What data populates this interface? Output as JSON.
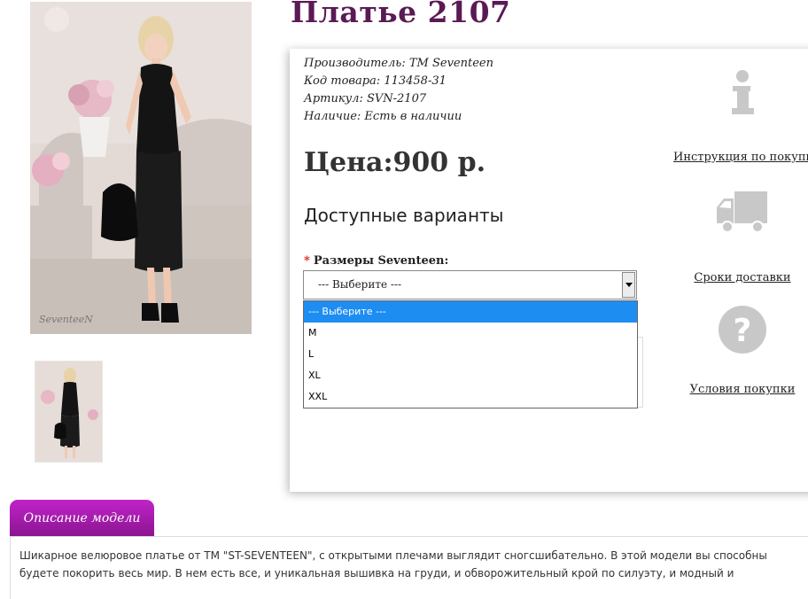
{
  "product": {
    "title": "Платье 2107",
    "meta": [
      {
        "label": "Производитель:",
        "value": "TM Seventeen"
      },
      {
        "label": "Код товара:",
        "value": "113458-31"
      },
      {
        "label": "Артикул:",
        "value": "SVN-2107"
      },
      {
        "label": "Наличие:",
        "value": "Есть в наличии"
      }
    ],
    "price": "Цена:900 р."
  },
  "images": {
    "watermark": "SeventeeN"
  },
  "variants": {
    "title": "Доступные варианты",
    "required_mark": "*",
    "size_label": "Размеры Seventeen:",
    "selected_value": "--- Выберите ---",
    "options": [
      "--- Выберите ---",
      "M",
      "L",
      "XL",
      "XXL"
    ]
  },
  "sidebar": {
    "items": [
      {
        "icon": "info-icon",
        "label": "Инструкция по покупке"
      },
      {
        "icon": "delivery-truck-icon",
        "label": "Сроки доставки"
      },
      {
        "icon": "question-icon",
        "label": "Условия покупки"
      }
    ]
  },
  "description": {
    "tab_label": "Описание модели",
    "lines": [
      "Шикарное велюровое платье от ТМ \"ST-SEVENTEEN\", с открытыми плечами выглядит сногсшибательно. В этой модели вы способны",
      "будете покорить весь мир. В нем есть все, и уникальная вышивка на груди, и обворожительный крой по силуэту, и модный и"
    ]
  },
  "colors": {
    "title": "#5a1a55",
    "tab": "#a81cae",
    "selected_option": "#1e8df2"
  }
}
